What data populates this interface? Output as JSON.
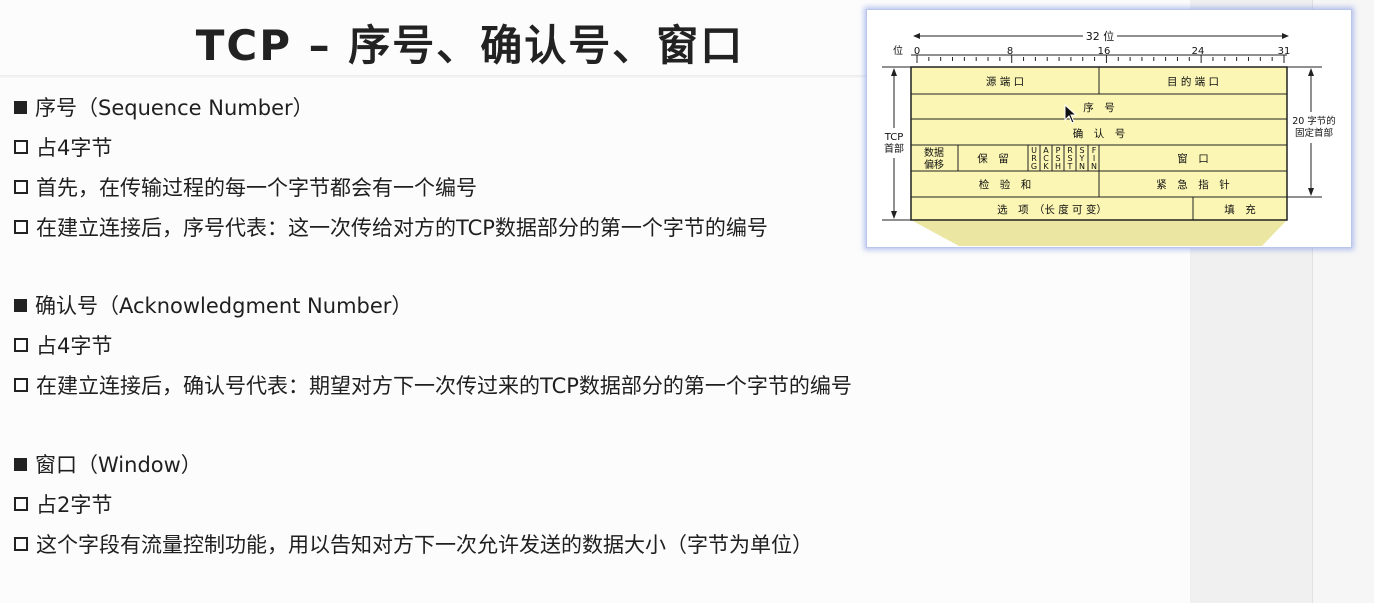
{
  "slide": {
    "title": "TCP  –  序号、确认号、窗口",
    "sections": [
      {
        "heading": "序号（Sequence Number）",
        "points": [
          "占4字节",
          "首先，在传输过程的每一个字节都会有一个编号",
          "在建立连接后，序号代表：这一次传给对方的TCP数据部分的第一个字节的编号"
        ]
      },
      {
        "heading": "确认号（Acknowledgment Number）",
        "points": [
          "占4字节",
          "在建立连接后，确认号代表：期望对方下一次传过来的TCP数据部分的第一个字节的编号"
        ]
      },
      {
        "heading": "窗口（Window）",
        "points": [
          "占2字节",
          "这个字段有流量控制功能，用以告知对方下一次允许发送的数据大小（字节为单位）"
        ]
      }
    ]
  },
  "diagram": {
    "bits_label": "32 位",
    "bit_axis_label": "位",
    "ticks": [
      "0",
      "8",
      "16",
      "24",
      "31"
    ],
    "left_label_1": "TCP",
    "left_label_2": "首部",
    "right_label_1": "20 字节的",
    "right_label_2": "固定首部",
    "fields": {
      "src_port": "源 端 口",
      "dst_port": "目 的 端 口",
      "seq": "序　号",
      "ack": "确　认　号",
      "offset_1": "数据",
      "offset_2": "偏移",
      "reserved": "保　留",
      "flags": [
        "URG",
        "ACK",
        "PSH",
        "RST",
        "SYN",
        "FIN"
      ],
      "window": "窗　口",
      "checksum": "检　验　和",
      "urgent": "紧　急　指　针",
      "options": "选　项　（长 度 可 变）",
      "padding": "填　充"
    },
    "colors": {
      "field_fill": "#fbf6b4",
      "trapezoid": "#ebe6a2"
    }
  }
}
